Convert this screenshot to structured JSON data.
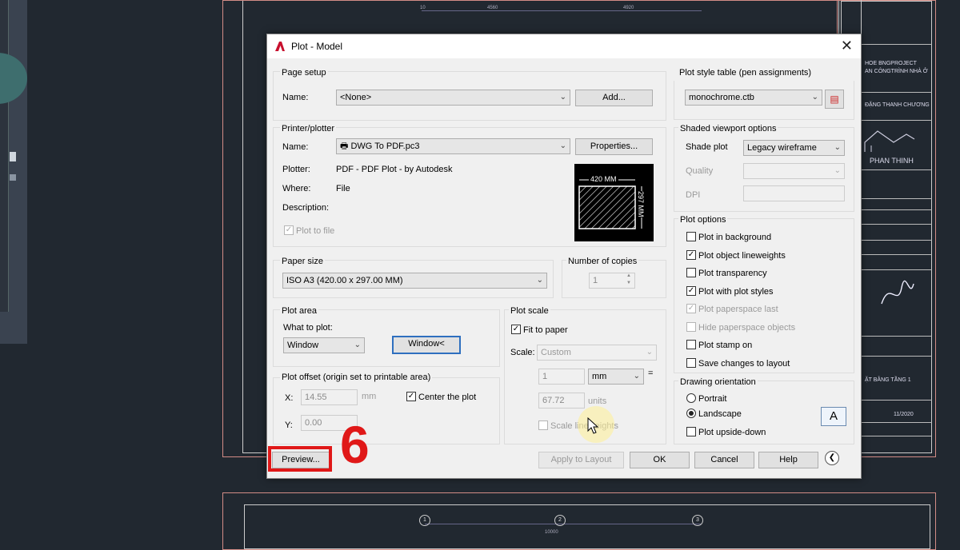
{
  "dialog": {
    "title": "Plot - Model",
    "page_setup": {
      "group_label": "Page setup",
      "name_label": "Name:",
      "name_value": "<None>",
      "add_button": "Add..."
    },
    "printer": {
      "group_label": "Printer/plotter",
      "name_label": "Name:",
      "name_value": "DWG To PDF.pc3",
      "properties_button": "Properties...",
      "plotter_label": "Plotter:",
      "plotter_value": "PDF - PDF Plot - by Autodesk",
      "where_label": "Where:",
      "where_value": "File",
      "description_label": "Description:",
      "plot_to_file": "Plot to file",
      "paper_width": "420  MM",
      "paper_height": "297 MM"
    },
    "paper_size": {
      "group_label": "Paper size",
      "value": "ISO A3 (420.00 x 297.00 MM)"
    },
    "copies": {
      "group_label": "Number of copies",
      "value": "1"
    },
    "plot_area": {
      "group_label": "Plot area",
      "what_label": "What to plot:",
      "what_value": "Window",
      "window_button": "Window<"
    },
    "plot_offset": {
      "group_label": "Plot offset (origin set to printable area)",
      "x_label": "X:",
      "x_value": "14.55",
      "x_unit": "mm",
      "y_label": "Y:",
      "y_value": "0.00",
      "center_label": "Center the plot"
    },
    "plot_scale": {
      "group_label": "Plot scale",
      "fit_label": "Fit to paper",
      "scale_label": "Scale:",
      "scale_value": "Custom",
      "num_value": "1",
      "unit_value": "mm",
      "equals": "=",
      "units_value": "67.72",
      "units_label": "units",
      "scale_lw_label": "Scale lineweights"
    },
    "plot_style": {
      "group_label": "Plot style table (pen assignments)",
      "value": "monochrome.ctb"
    },
    "shaded": {
      "group_label": "Shaded viewport options",
      "shade_label": "Shade plot",
      "shade_value": "Legacy wireframe",
      "quality_label": "Quality",
      "dpi_label": "DPI"
    },
    "plot_options": {
      "group_label": "Plot options",
      "items": [
        {
          "label": "Plot in background",
          "checked": false,
          "disabled": false
        },
        {
          "label": "Plot object lineweights",
          "checked": true,
          "disabled": false
        },
        {
          "label": "Plot transparency",
          "checked": false,
          "disabled": false
        },
        {
          "label": "Plot with plot styles",
          "checked": true,
          "disabled": false
        },
        {
          "label": "Plot paperspace last",
          "checked": true,
          "disabled": true
        },
        {
          "label": "Hide paperspace objects",
          "checked": false,
          "disabled": true
        },
        {
          "label": "Plot stamp on",
          "checked": false,
          "disabled": false
        },
        {
          "label": "Save changes to layout",
          "checked": false,
          "disabled": false
        }
      ]
    },
    "orientation": {
      "group_label": "Drawing orientation",
      "portrait": "Portrait",
      "landscape": "Landscape",
      "upside_down": "Plot upside-down",
      "icon_letter": "A"
    },
    "buttons": {
      "preview": "Preview...",
      "apply": "Apply to Layout",
      "ok": "OK",
      "cancel": "Cancel",
      "help": "Help"
    }
  },
  "annotation": {
    "step_number": "6",
    "highlight_color": "#e01818"
  },
  "cad": {
    "titleblock_lines": [
      "HOE BNGPROJECT",
      "AN CÔNGTRÌNH NHÀ Ở",
      "ĐẶNG THANH CHƯƠNG",
      "PHAN THINH",
      "ẶT BẰNG TẦNG 1",
      "11/2020"
    ],
    "dims": [
      "10",
      "4560",
      "4920"
    ],
    "grid_labels": [
      "1",
      "2",
      "3"
    ],
    "bottom_dim": "10000"
  }
}
